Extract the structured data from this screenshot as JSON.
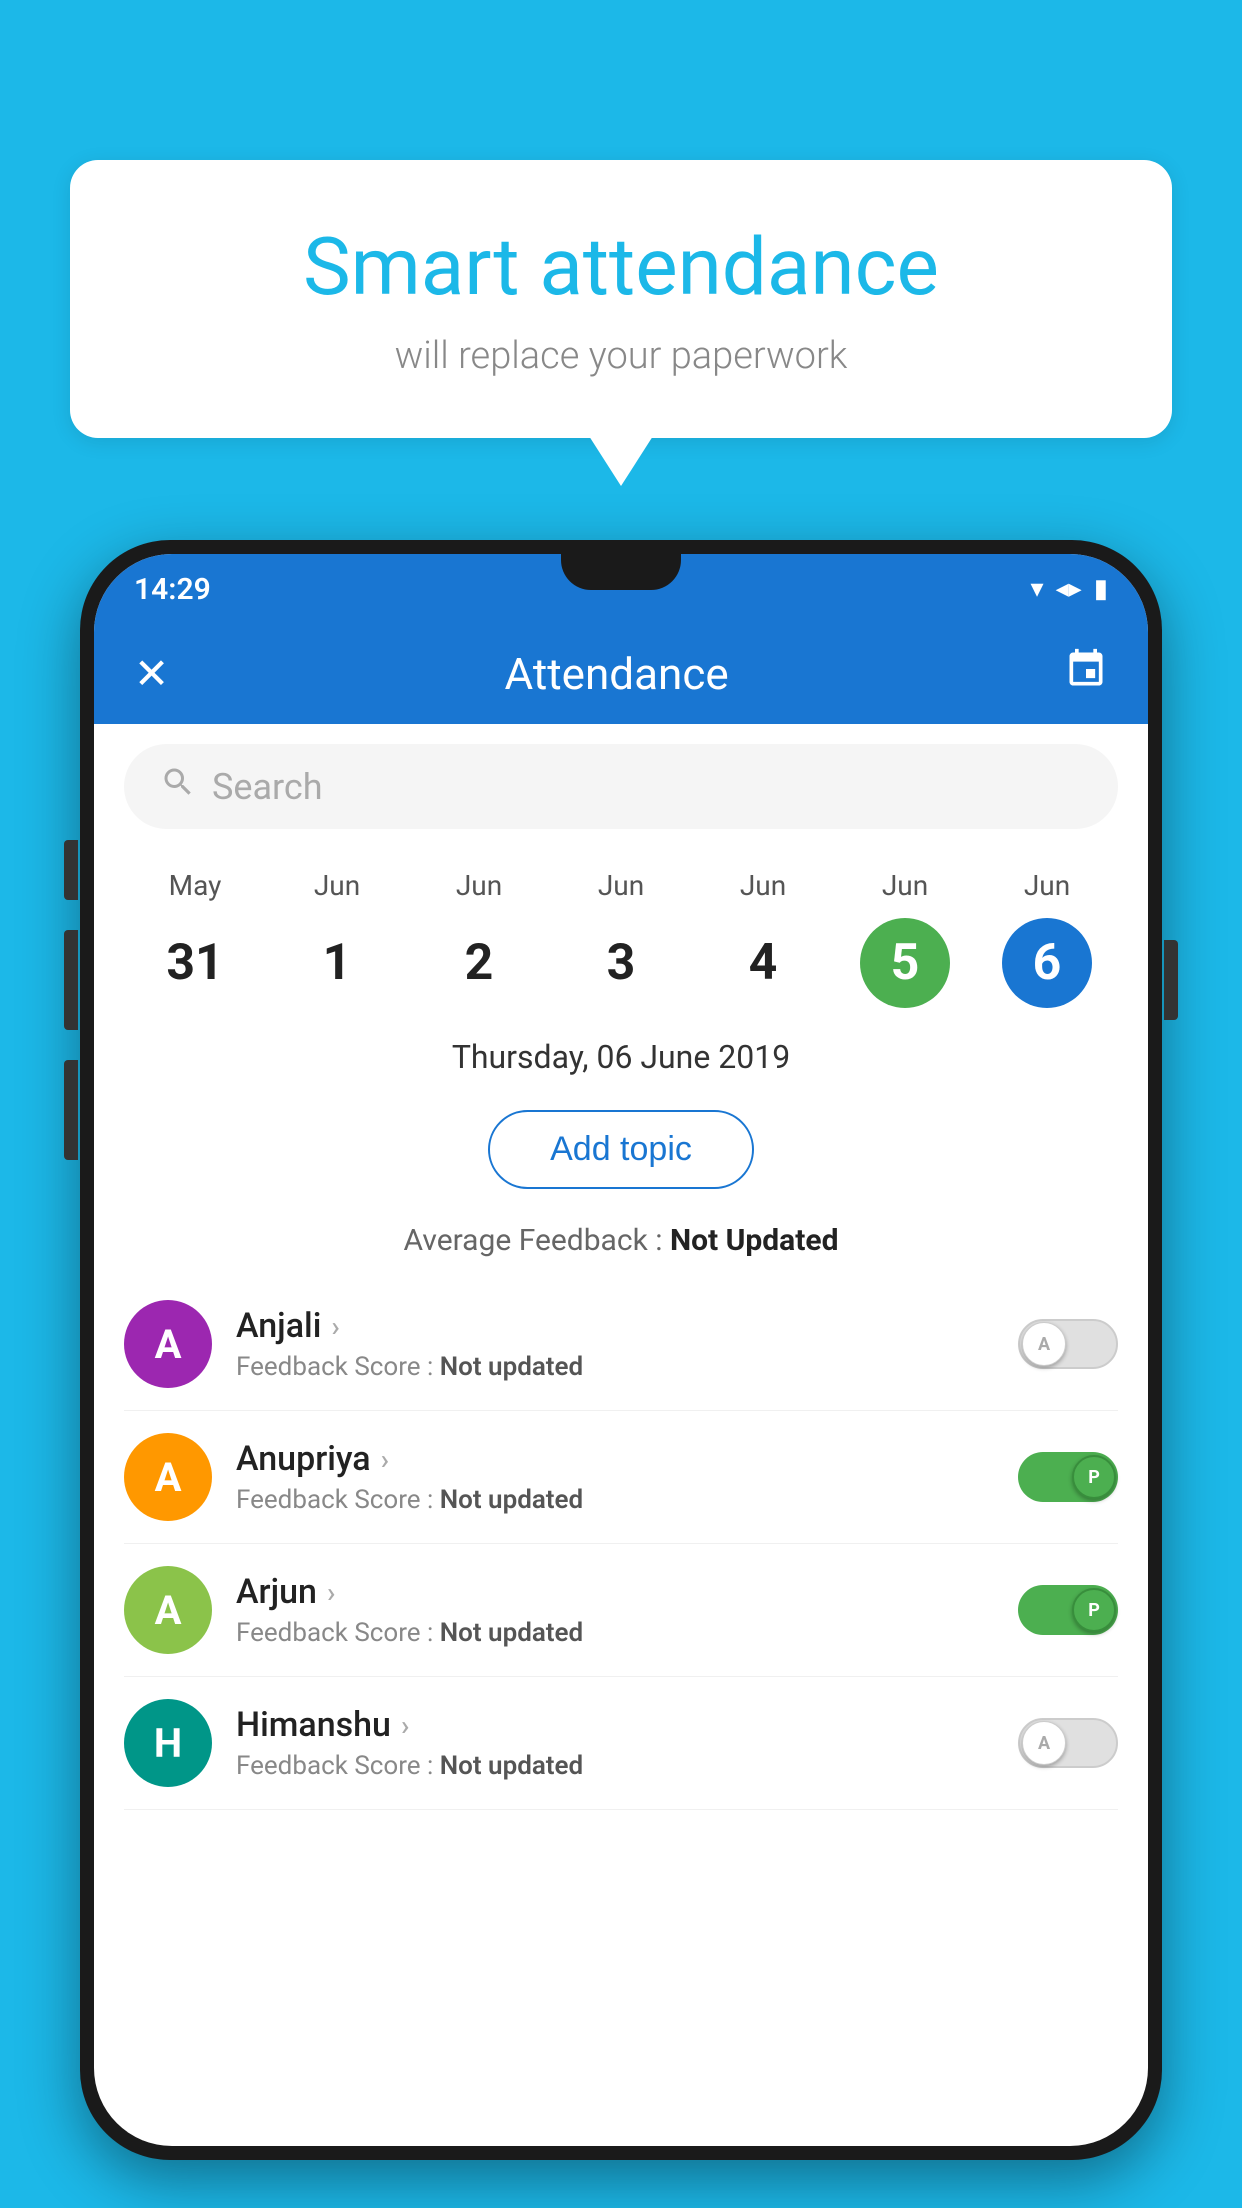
{
  "background_color": "#1cb8e8",
  "bubble": {
    "title": "Smart attendance",
    "subtitle": "will replace your paperwork"
  },
  "status_bar": {
    "time": "14:29",
    "wifi_icon": "▾",
    "signal_icon": "▲",
    "battery_icon": "▮"
  },
  "app_header": {
    "close_label": "✕",
    "title": "Attendance",
    "calendar_icon": "📅"
  },
  "search": {
    "placeholder": "Search"
  },
  "calendar": {
    "days": [
      {
        "month": "May",
        "date": "31",
        "style": "normal"
      },
      {
        "month": "Jun",
        "date": "1",
        "style": "normal"
      },
      {
        "month": "Jun",
        "date": "2",
        "style": "normal"
      },
      {
        "month": "Jun",
        "date": "3",
        "style": "normal"
      },
      {
        "month": "Jun",
        "date": "4",
        "style": "normal"
      },
      {
        "month": "Jun",
        "date": "5",
        "style": "today"
      },
      {
        "month": "Jun",
        "date": "6",
        "style": "selected"
      }
    ]
  },
  "selected_date": "Thursday, 06 June 2019",
  "add_topic_label": "Add topic",
  "average_feedback": {
    "label": "Average Feedback : ",
    "value": "Not Updated"
  },
  "students": [
    {
      "name": "Anjali",
      "avatar_letter": "A",
      "avatar_color": "purple",
      "feedback_label": "Feedback Score : ",
      "feedback_value": "Not updated",
      "toggle_state": "off",
      "toggle_letter": "A"
    },
    {
      "name": "Anupriya",
      "avatar_letter": "A",
      "avatar_color": "orange",
      "feedback_label": "Feedback Score : ",
      "feedback_value": "Not updated",
      "toggle_state": "on",
      "toggle_letter": "P"
    },
    {
      "name": "Arjun",
      "avatar_letter": "A",
      "avatar_color": "lightgreen",
      "feedback_label": "Feedback Score : ",
      "feedback_value": "Not updated",
      "toggle_state": "on",
      "toggle_letter": "P"
    },
    {
      "name": "Himanshu",
      "avatar_letter": "H",
      "avatar_color": "teal",
      "feedback_label": "Feedback Score : ",
      "feedback_value": "Not updated",
      "toggle_state": "off",
      "toggle_letter": "A"
    }
  ]
}
